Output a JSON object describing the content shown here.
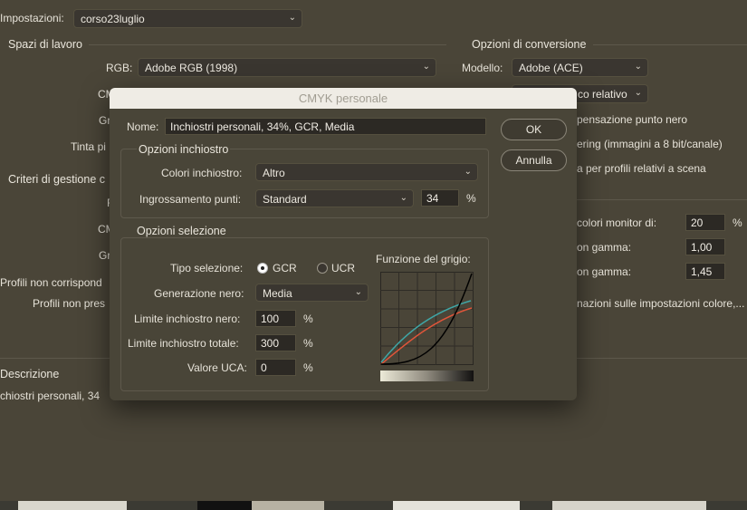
{
  "top": {
    "impostazioni_label": "Impostazioni:",
    "impostazioni_value": "corso23luglio"
  },
  "spazi": {
    "title": "Spazi di lavoro",
    "rgb_label": "RGB:",
    "rgb_value": "Adobe RGB (1998)",
    "cmyk_label_cut": "CM",
    "grigio_label_cut": "Gr",
    "tinta_label_cut": "Tinta pi"
  },
  "criteri": {
    "title_cut": "Criteri di gestione c",
    "row1_cut": "F",
    "row2_cut": "CM",
    "row3_cut": "Gr",
    "profili_corr_cut": "Profili non corrispond",
    "profili_pres_cut": "Profili non pres"
  },
  "conversione": {
    "title": "Opzioni di conversione",
    "modello_label": "Modello:",
    "modello_value": "Adobe (ACE)",
    "intento_cut": "co relativo",
    "comp_cut": "pensazione punto nero",
    "dither_cut": "ering (immagini a 8 bit/canale)",
    "scena_cut": "a per profili relativi a scena"
  },
  "avanzate": {
    "monitor_cut": "colori monitor di:",
    "monitor_value": "20",
    "monitor_unit": "%",
    "gamma1_cut": "on gamma:",
    "gamma1_value": "1,00",
    "gamma2_cut": "on gamma:",
    "gamma2_value": "1,45",
    "info_cut": "nazioni sulle impostazioni colore,..."
  },
  "descrizione": {
    "title": "Descrizione",
    "text_cut": "chiostri personali, 34"
  },
  "dialog": {
    "title": "CMYK personale",
    "nome_label": "Nome:",
    "nome_value": "Inchiostri personali, 34%, GCR, Media",
    "ok_label": "OK",
    "annulla_label": "Annulla",
    "ink": {
      "title": "Opzioni inchiostro",
      "colori_label": "Colori inchiostro:",
      "colori_value": "Altro",
      "ingross_label": "Ingrossamento punti:",
      "ingross_value": "Standard",
      "ingross_num": "34",
      "ingross_unit": "%"
    },
    "sep": {
      "title": "Opzioni selezione",
      "tipo_label": "Tipo selezione:",
      "gcr_label": "GCR",
      "ucr_label": "UCR",
      "gcr_selected": true,
      "gen_label": "Generazione nero:",
      "gen_value": "Media",
      "lim_nero_label": "Limite inchiostro nero:",
      "lim_nero_value": "100",
      "lim_nero_unit": "%",
      "lim_tot_label": "Limite inchiostro totale:",
      "lim_tot_value": "300",
      "lim_tot_unit": "%",
      "uca_label": "Valore UCA:",
      "uca_value": "0",
      "uca_unit": "%",
      "grigio_title": "Funzione del grigio:"
    }
  },
  "colors": {
    "bg": "#4a4538",
    "dialog_bg": "#494538",
    "cyan_curve": "#3fa6a6",
    "red_curve": "#e0553a",
    "black_curve": "#000000"
  }
}
